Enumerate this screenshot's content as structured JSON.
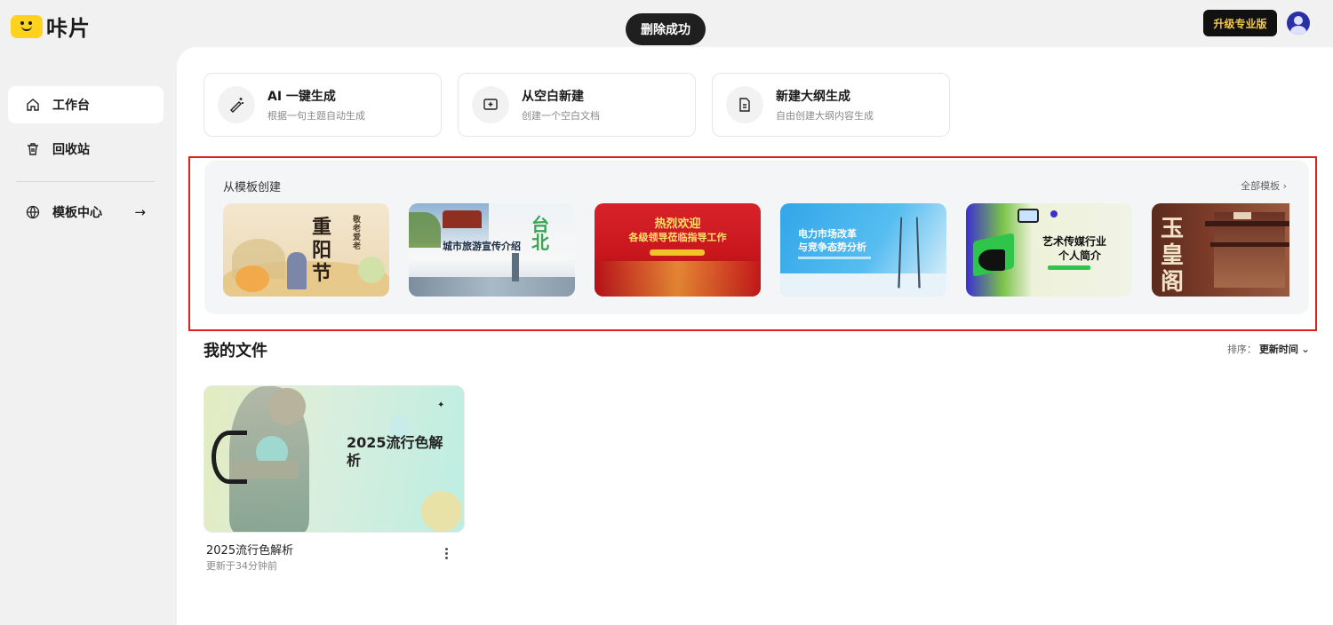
{
  "app": {
    "name": "咔片"
  },
  "toast": {
    "text": "删除成功"
  },
  "header": {
    "upgrade_label": "升级专业版"
  },
  "sidebar": {
    "items": [
      {
        "label": "工作台",
        "icon": "home-icon",
        "active": true
      },
      {
        "label": "回收站",
        "icon": "trash-icon",
        "active": false
      },
      {
        "label": "模板中心",
        "icon": "globe-icon",
        "active": false
      }
    ]
  },
  "quick_actions": [
    {
      "title": "AI 一键生成",
      "subtitle": "根据一句主题自动生成",
      "icon": "magic-wand-icon"
    },
    {
      "title": "从空白新建",
      "subtitle": "创建一个空白文档",
      "icon": "add-slide-icon"
    },
    {
      "title": "新建大纲生成",
      "subtitle": "自由创建大纲内容生成",
      "icon": "document-icon"
    }
  ],
  "templates": {
    "title": "从模板创建",
    "all_label": "全部模板",
    "items": [
      {
        "title": "重阳节",
        "subtitle": "敬老爱老"
      },
      {
        "title": "城市旅游宣传介绍",
        "subtitle": "台北"
      },
      {
        "title": "热烈欢迎",
        "subtitle": "各级领导莅临指导工作"
      },
      {
        "title": "电力市场改革",
        "subtitle": "与竞争态势分析"
      },
      {
        "title": "艺术传媒行业",
        "subtitle": "个人简介"
      },
      {
        "title": "玉皇阁",
        "subtitle": ""
      }
    ]
  },
  "files": {
    "title": "我的文件",
    "sort_label": "排序：",
    "sort_value": "更新时间",
    "items": [
      {
        "thumb_title": "2025流行色解析",
        "name": "2025流行色解析",
        "updated": "更新于34分钟前"
      }
    ]
  },
  "colors": {
    "accent": "#ffd21e",
    "highlight": "#e0201d",
    "upgrade_text": "#f5c945"
  }
}
